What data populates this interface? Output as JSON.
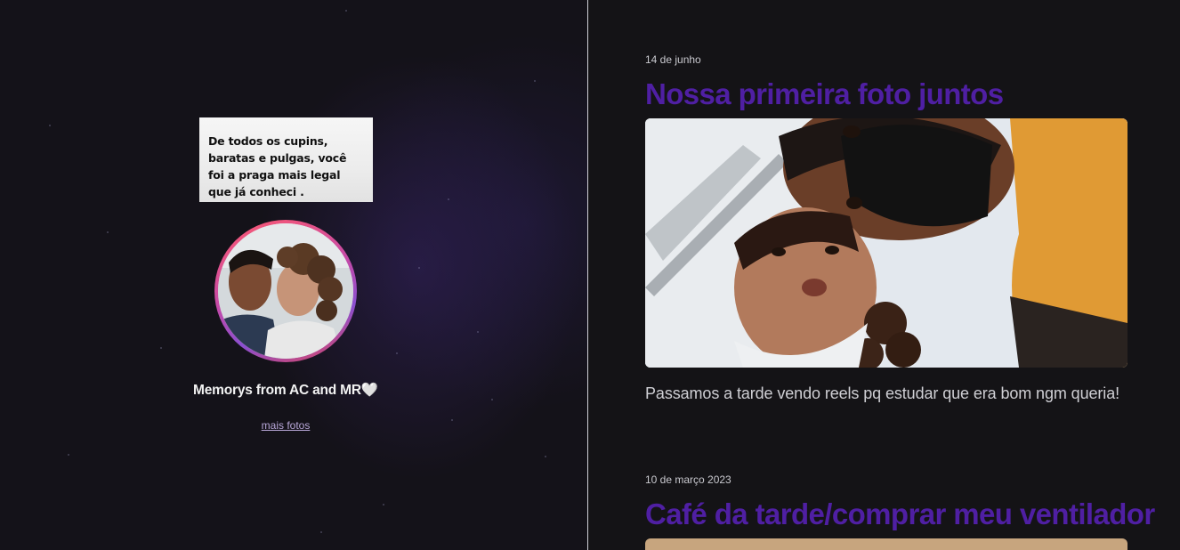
{
  "sidebar": {
    "quote": "De todos os cupins, baratas e pulgas, você foi a praga mais legal que já conheci .",
    "profile_name": "Memorys from AC and MR🤍",
    "more_photos_link": "mais fotos"
  },
  "feed": {
    "posts": [
      {
        "date": "14 de junho",
        "title": "Nossa primeira foto juntos",
        "caption": "Passamos a tarde vendo reels pq estudar que era bom ngm queria!"
      },
      {
        "date": "10 de março 2023",
        "title": "Café da tarde/comprar meu ventilador"
      }
    ]
  },
  "colors": {
    "title_purple": "#4f1fa3",
    "background": "#141316",
    "ring_gradient_start": "#ff5a6e",
    "ring_gradient_end": "#8a4fd0"
  }
}
